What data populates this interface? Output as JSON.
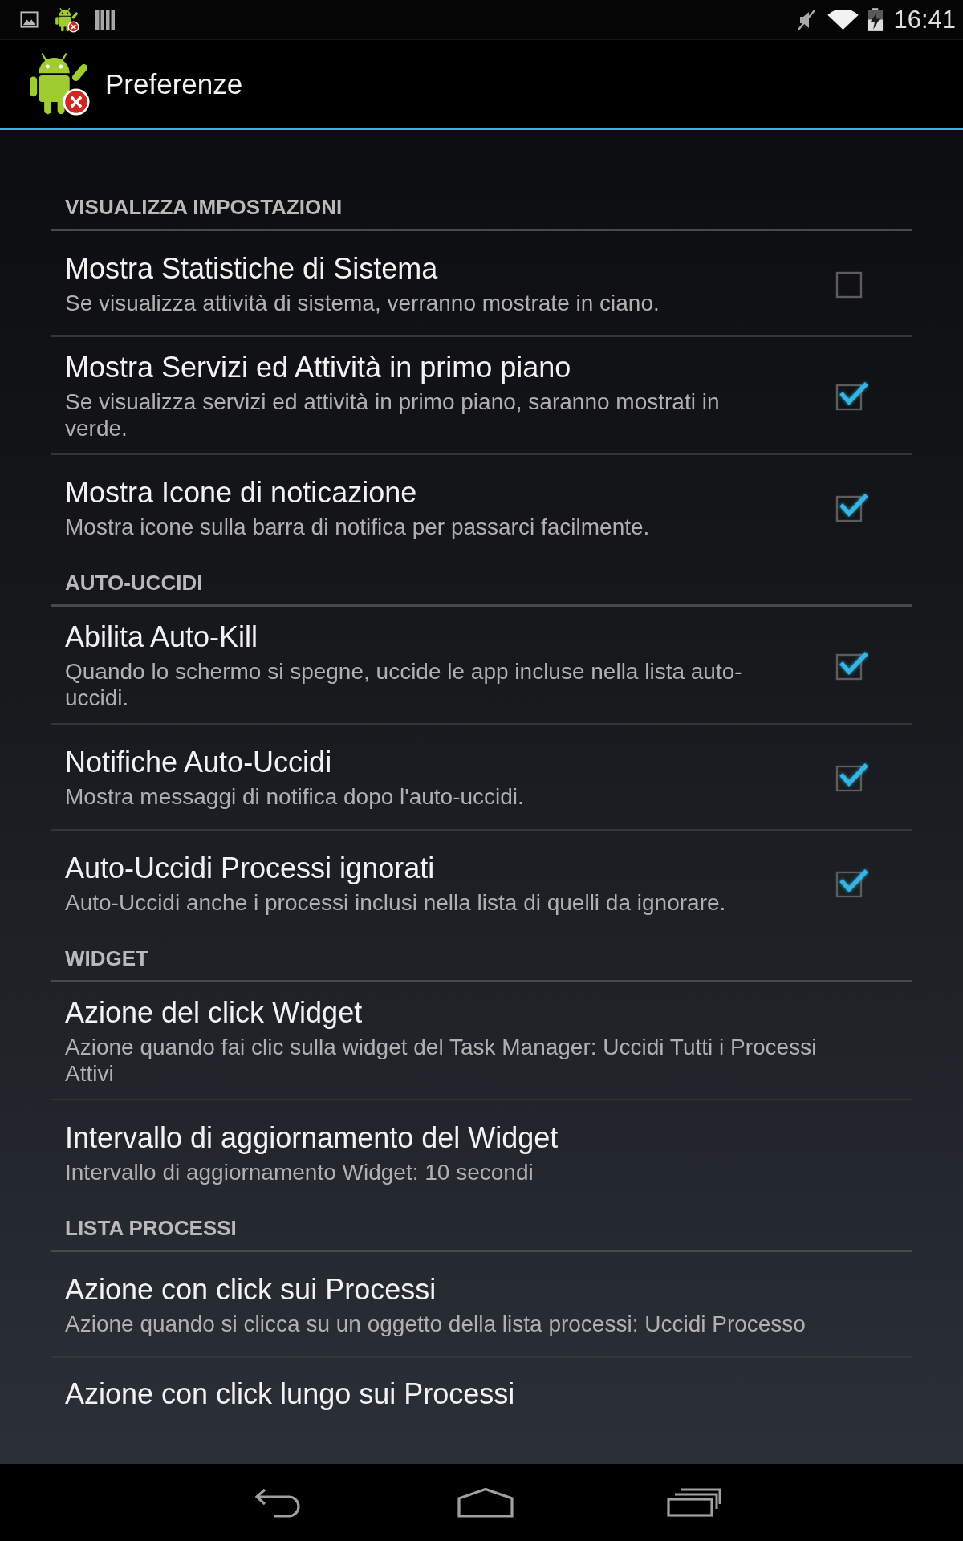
{
  "status_bar": {
    "time": "16:41"
  },
  "action_bar": {
    "title": "Preferenze"
  },
  "sections": [
    {
      "header": "VISUALIZZA IMPOSTAZIONI",
      "items": [
        {
          "kind": "checkbox",
          "title": "Mostra Statistiche di Sistema",
          "summary": "Se visualizza attività di sistema, verranno mostrate in ciano.",
          "checked": false
        },
        {
          "kind": "checkbox",
          "title": "Mostra Servizi ed Attività in primo piano",
          "summary": "Se visualizza servizi ed attività in primo piano, saranno mostrati in verde.",
          "checked": true
        },
        {
          "kind": "checkbox",
          "title": "Mostra Icone di noticazione",
          "summary": "Mostra icone sulla barra di notifica per passarci facilmente.",
          "checked": true
        }
      ]
    },
    {
      "header": "AUTO-UCCIDI",
      "items": [
        {
          "kind": "checkbox",
          "title": "Abilita Auto-Kill",
          "summary": "Quando lo schermo si spegne, uccide le app incluse nella lista auto-uccidi.",
          "checked": true
        },
        {
          "kind": "checkbox",
          "title": "Notifiche Auto-Uccidi",
          "summary": "Mostra messaggi di notifica dopo l'auto-uccidi.",
          "checked": true
        },
        {
          "kind": "checkbox",
          "title": "Auto-Uccidi Processi ignorati",
          "summary": "Auto-Uccidi anche i processi inclusi nella lista di quelli da ignorare.",
          "checked": true
        }
      ]
    },
    {
      "header": "WIDGET",
      "items": [
        {
          "kind": "plain",
          "title": "Azione del click Widget",
          "summary": "Azione quando fai clic sulla widget del Task Manager: Uccidi Tutti i Processi Attivi"
        },
        {
          "kind": "plain",
          "title": "Intervallo di aggiornamento del Widget",
          "summary": "Intervallo di aggiornamento Widget: 10 secondi"
        }
      ]
    },
    {
      "header": "LISTA PROCESSI",
      "items": [
        {
          "kind": "plain",
          "title": "Azione con click sui Processi",
          "summary": "Azione quando si clicca su un oggetto della lista processi: Uccidi Processo"
        },
        {
          "kind": "plain",
          "title": "Azione con click lungo sui Processi"
        }
      ]
    }
  ]
}
